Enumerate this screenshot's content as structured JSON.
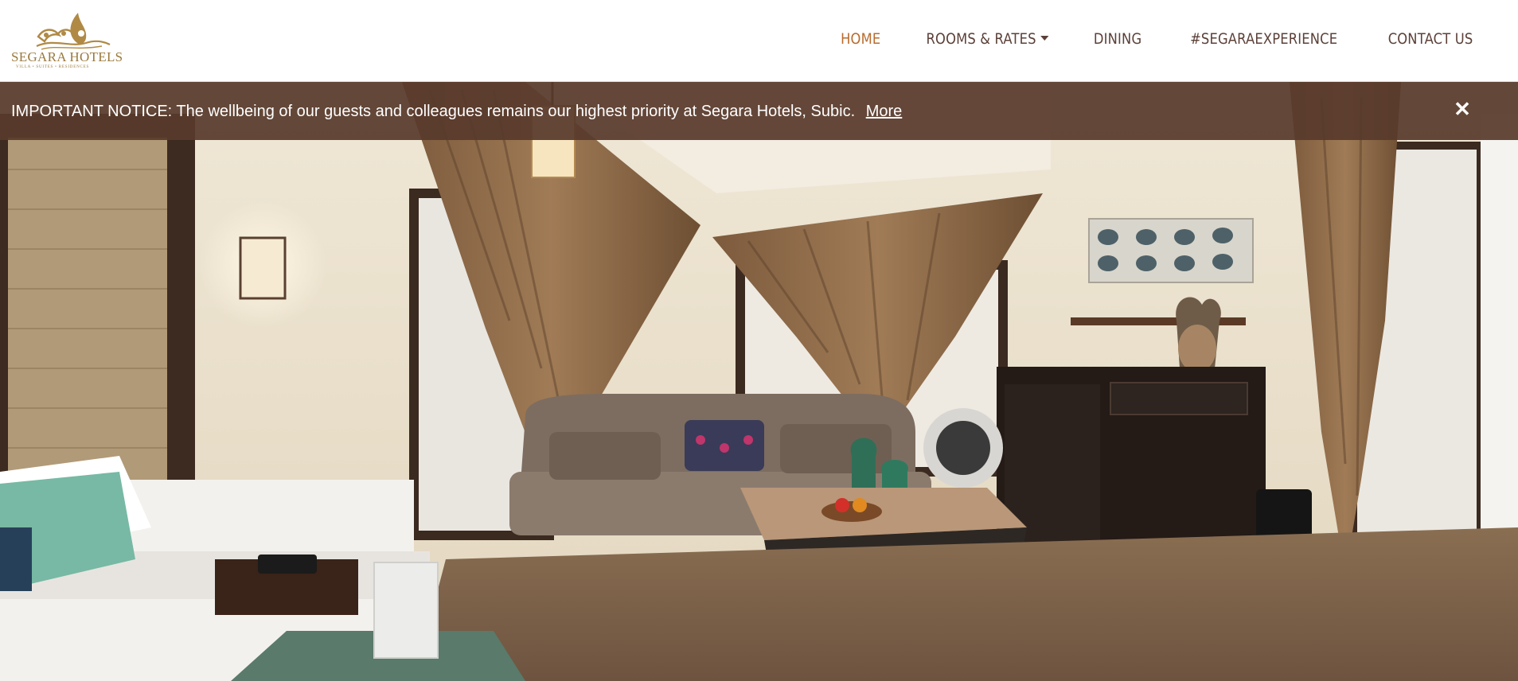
{
  "brand": {
    "name": "SEGARA HOTELS",
    "tagline": "VILLA • SUITES • RESIDENCES",
    "color": "#9a7a3c"
  },
  "nav": {
    "items": [
      {
        "label": "HOME",
        "active": true
      },
      {
        "label": "ROOMS & RATES",
        "dropdown": true
      },
      {
        "label": "DINING"
      },
      {
        "label": "#SEGARAEXPERIENCE"
      },
      {
        "label": "CONTACT US"
      }
    ],
    "active_color": "#b86b2d",
    "text_color": "#5b4038"
  },
  "notice": {
    "text": "IMPORTANT NOTICE: The wellbeing of our guests and colleagues remains our highest priority at Segara Hotels, Subic.",
    "link_label": "More",
    "close_icon": "close-icon",
    "background": "#583a2c"
  },
  "hero": {
    "icon": "hotel-room-photo"
  }
}
